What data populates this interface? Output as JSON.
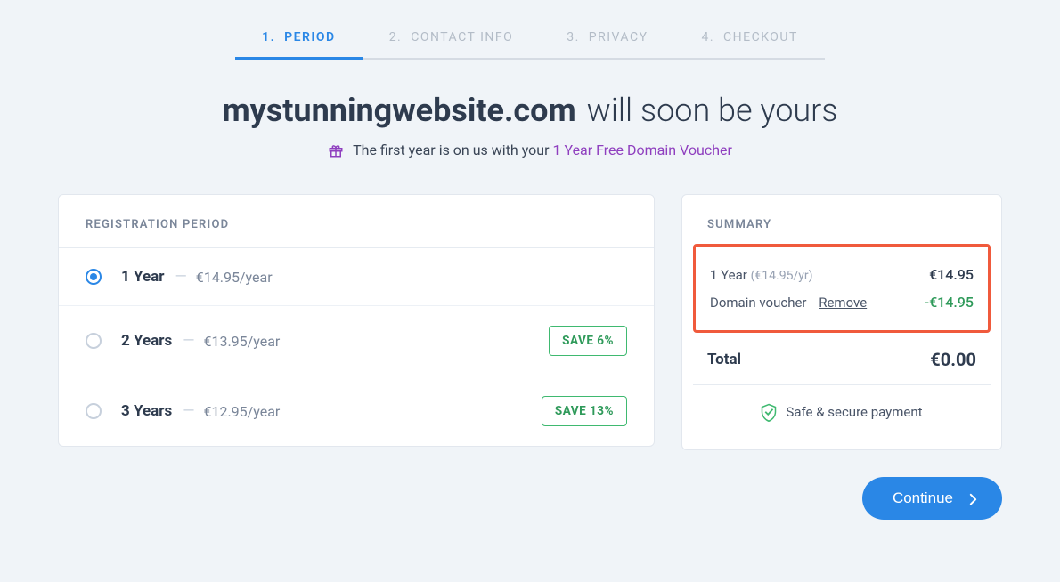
{
  "stepper": {
    "steps": [
      {
        "num": "1.",
        "label": "PERIOD"
      },
      {
        "num": "2.",
        "label": "CONTACT INFO"
      },
      {
        "num": "3.",
        "label": "PRIVACY"
      },
      {
        "num": "4.",
        "label": "CHECKOUT"
      }
    ],
    "active_index": 0
  },
  "heading": {
    "domain": "mystunningwebsite.com",
    "rest": "will soon be yours"
  },
  "subheading": {
    "prefix": "The first year is on us with your",
    "voucher": "1 Year Free Domain Voucher"
  },
  "registration": {
    "header": "REGISTRATION PERIOD",
    "periods": [
      {
        "label": "1 Year",
        "price": "€14.95/year",
        "selected": true,
        "save": null
      },
      {
        "label": "2 Years",
        "price": "€13.95/year",
        "selected": false,
        "save": "SAVE 6%"
      },
      {
        "label": "3 Years",
        "price": "€12.95/year",
        "selected": false,
        "save": "SAVE 13%"
      }
    ]
  },
  "summary": {
    "header": "SUMMARY",
    "lines": [
      {
        "label": "1 Year",
        "sub": "(€14.95/yr)",
        "amount": "€14.95",
        "discount": false
      },
      {
        "label": "Domain voucher",
        "remove": "Remove",
        "amount": "-€14.95",
        "discount": true
      }
    ],
    "total_label": "Total",
    "total_amount": "€0.00",
    "secure_text": "Safe & secure payment"
  },
  "continue_label": "Continue"
}
